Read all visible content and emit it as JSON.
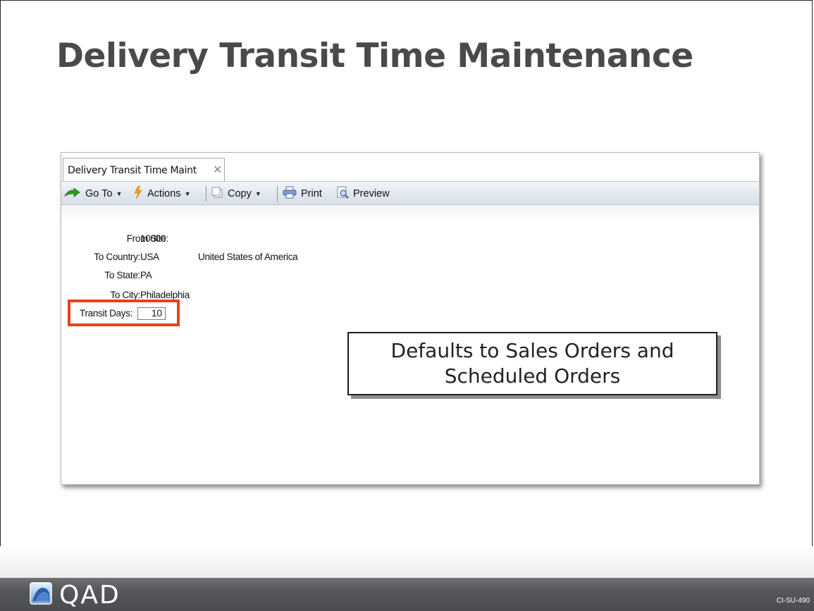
{
  "slide": {
    "title": "Delivery Transit Time Maintenance",
    "code": "CI-SU-490"
  },
  "window": {
    "tab_label": "Delivery Transit Time Maint",
    "tab_close_icon": "close-icon"
  },
  "toolbar": {
    "goto_label": "Go To",
    "actions_label": "Actions",
    "copy_label": "Copy",
    "print_label": "Print",
    "preview_label": "Preview"
  },
  "form": {
    "from_site_label": "From Site:",
    "from_site_value": "10000",
    "to_country_label": "To Country:",
    "to_country_value": "USA",
    "to_country_desc": "United States of America",
    "to_state_label": "To State:",
    "to_state_value": "PA",
    "to_city_label": "To City:",
    "to_city_value": "Philadelphia",
    "transit_days_label": "Transit Days:",
    "transit_days_value": "10"
  },
  "callout": {
    "text": "Defaults to Sales Orders and\nScheduled Orders"
  },
  "footer": {
    "logo_text": "QAD"
  },
  "colors": {
    "highlight": "#e8411b",
    "title": "#4a4a4a",
    "footer": "#55575b"
  }
}
